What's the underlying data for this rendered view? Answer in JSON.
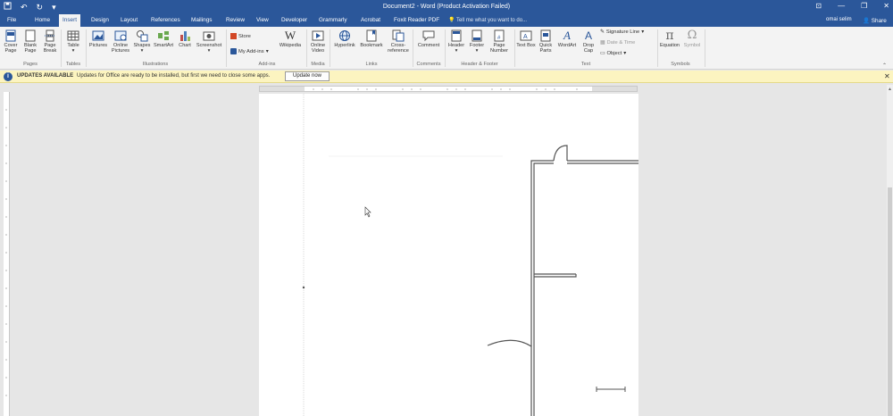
{
  "titlebar": {
    "title": "Document2 - Word (Product Activation Failed)",
    "qat": [
      "save-icon",
      "undo-icon",
      "redo-icon",
      "customize-icon"
    ]
  },
  "tabs": [
    "File",
    "Home",
    "Insert",
    "Design",
    "Layout",
    "References",
    "Mailings",
    "Review",
    "View",
    "Developer",
    "Grammarly",
    "Acrobat",
    "Foxit Reader PDF"
  ],
  "active_tab": "Insert",
  "tell_me": "Tell me what you want to do...",
  "user": "omai selim",
  "share": "Share",
  "ribbon": {
    "pages": {
      "cover_page": "Cover Page",
      "blank_page": "Blank Page",
      "page_break": "Page Break",
      "label": "Pages"
    },
    "tables": {
      "table": "Table",
      "label": "Tables"
    },
    "illustrations": {
      "pictures": "Pictures",
      "online_pictures": "Online Pictures",
      "shapes": "Shapes",
      "smartart": "SmartArt",
      "chart": "Chart",
      "screenshot": "Screenshot",
      "label": "Illustrations"
    },
    "addins": {
      "store": "Store",
      "my_addins": "My Add-ins",
      "wikipedia": "Wikipedia",
      "label": "Add-ins"
    },
    "media": {
      "online_video": "Online Video",
      "label": "Media"
    },
    "links": {
      "hyperlink": "Hyperlink",
      "bookmark": "Bookmark",
      "cross_reference": "Cross-reference",
      "label": "Links"
    },
    "comments": {
      "comment": "Comment",
      "label": "Comments"
    },
    "header_footer": {
      "header": "Header",
      "footer": "Footer",
      "page_number": "Page Number",
      "label": "Header & Footer"
    },
    "text": {
      "text_box": "Text Box",
      "quick_parts": "Quick Parts",
      "wordart": "WordArt",
      "drop_cap": "Drop Cap",
      "signature_line": "Signature Line",
      "date_time": "Date & Time",
      "object": "Object",
      "label": "Text"
    },
    "symbols": {
      "equation": "Equation",
      "symbol": "Symbol",
      "label": "Symbols"
    }
  },
  "message_bar": {
    "title": "UPDATES AVAILABLE",
    "text": "Updates for Office are ready to be installed, but first we need to close some apps.",
    "button": "Update now"
  },
  "colors": {
    "brand": "#2b579a",
    "message_bg": "#fcf4c0"
  }
}
